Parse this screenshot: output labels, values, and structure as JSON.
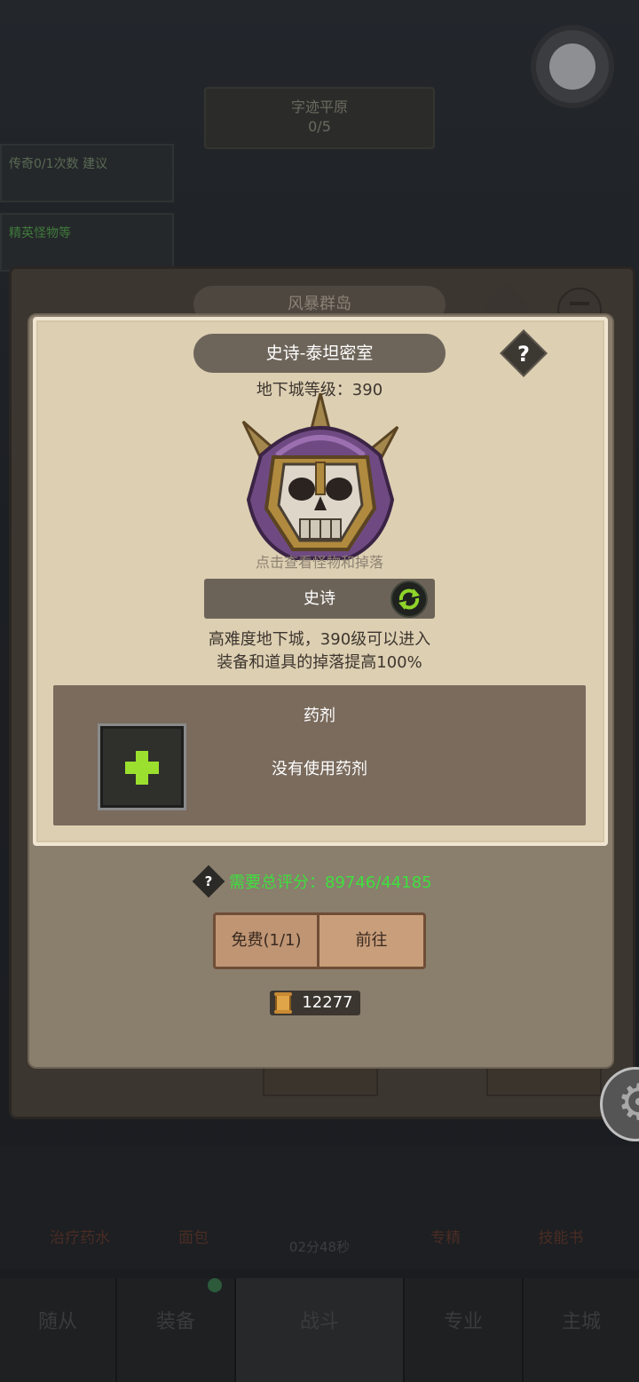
{
  "background": {
    "top_banner": "字迹平原",
    "top_banner_sub": "0/5",
    "side_tabs": [
      "传奇0/1次数\n建议",
      "精英怪物等"
    ],
    "outer_title": "风暴群岛",
    "items": [
      "治疗药水",
      "面包",
      "专精",
      "技能书"
    ],
    "timer": "02分48秒",
    "nav": [
      "随从",
      "装备",
      "战斗",
      "专业",
      "主城"
    ]
  },
  "dialog": {
    "title": "史诗-泰坦密室",
    "help_symbol": "?",
    "dungeon_level": "地下城等级：390",
    "boss_hint": "点击查看怪物和掉落",
    "difficulty": "史诗",
    "description_line1": "高难度地下城，390级可以进入",
    "description_line2": "装备和道具的掉落提高100%",
    "potion": {
      "title": "药剂",
      "add_symbol": "+",
      "empty_text": "没有使用药剂"
    },
    "requirement": "需要总评分：89746/44185",
    "requirement_help": "?",
    "free_button": "免费(1/1)",
    "go_button": "前往",
    "scroll_count": "12277"
  },
  "colors": {
    "accent_green": "#3ee03e",
    "plus_green": "#9be02f",
    "wood": "#c49a78"
  },
  "icons": {
    "help": "question-diamond-icon",
    "swap": "swap-arrows-icon",
    "settings": "gear-icon",
    "scroll": "scroll-icon",
    "boss": "skull-helmet-icon"
  }
}
